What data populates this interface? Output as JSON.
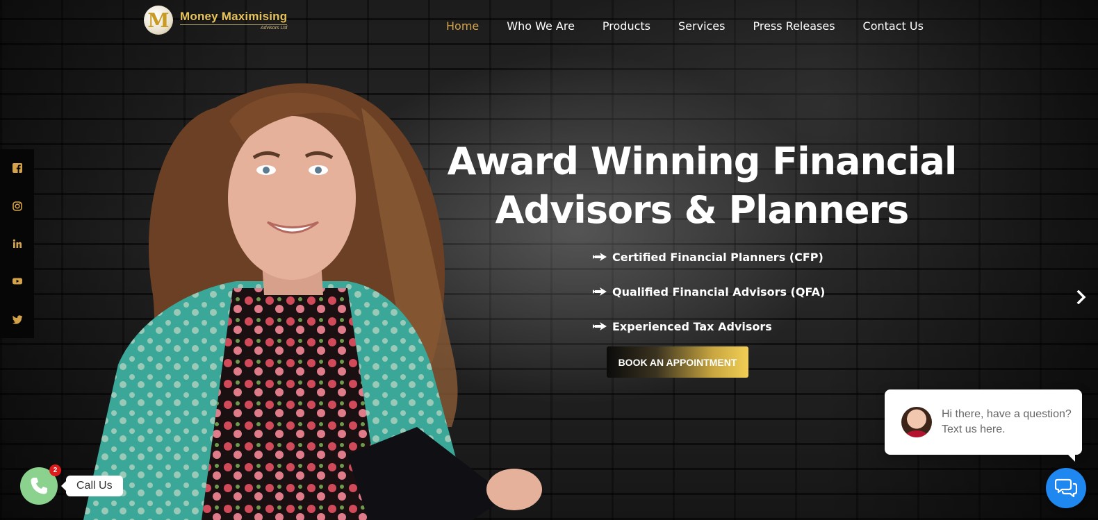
{
  "brand": {
    "logo_letter": "M",
    "name": "Money Maximising",
    "subtitle": "Advisors Ltd",
    "accent_color": "#d6a44a"
  },
  "nav": {
    "items": [
      {
        "label": "Home",
        "active": true
      },
      {
        "label": "Who We Are",
        "active": false
      },
      {
        "label": "Products",
        "active": false
      },
      {
        "label": "Services",
        "active": false
      },
      {
        "label": "Press Releases",
        "active": false
      },
      {
        "label": "Contact Us",
        "active": false
      }
    ]
  },
  "social": {
    "icons": [
      "facebook-icon",
      "instagram-icon",
      "linkedin-icon",
      "youtube-icon",
      "twitter-icon"
    ]
  },
  "hero": {
    "title_line1": "Award Winning Financial",
    "title_line2": "Advisors & Planners",
    "bullets": [
      "Certified Financial Planners (CFP)",
      "Qualified Financial Advisors (QFA)",
      "Experienced Tax Advisors"
    ],
    "cta_label": "BOOK AN APPOINTMENT"
  },
  "chat": {
    "message": "Hi there, have a question? Text us here.",
    "button_color": "#1e88f0"
  },
  "call": {
    "label": "Call Us",
    "badge_count": "2",
    "button_color": "#8ad28d"
  }
}
